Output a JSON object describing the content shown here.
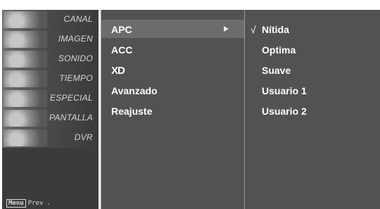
{
  "categories": [
    {
      "label": "CANAL",
      "icon": "channel-icon"
    },
    {
      "label": "IMAGEN",
      "icon": "picture-icon"
    },
    {
      "label": "SONIDO",
      "icon": "sound-icon"
    },
    {
      "label": "TIEMPO",
      "icon": "clock-icon"
    },
    {
      "label": "ESPECIAL",
      "icon": "special-icon"
    },
    {
      "label": "PANTALLA",
      "icon": "screen-icon"
    },
    {
      "label": "DVR",
      "icon": "dvr-icon"
    }
  ],
  "footer": {
    "menu_key": "Menu",
    "prev_label": "Prev ."
  },
  "menu": {
    "items": [
      {
        "label": "APC",
        "has_submenu": true,
        "selected": true
      },
      {
        "label": "ACC"
      },
      {
        "label": "XD"
      },
      {
        "label": "Avanzado"
      },
      {
        "label": "Reajuste"
      }
    ]
  },
  "options": {
    "items": [
      {
        "label": "Nítida",
        "checked": true
      },
      {
        "label": "Optima"
      },
      {
        "label": "Suave"
      },
      {
        "label": "Usuario 1"
      },
      {
        "label": "Usuario 2"
      }
    ],
    "check_mark": "√"
  },
  "colors": {
    "panel": "#525252",
    "highlight": "#6c6c6c",
    "text": "#ffffff"
  }
}
